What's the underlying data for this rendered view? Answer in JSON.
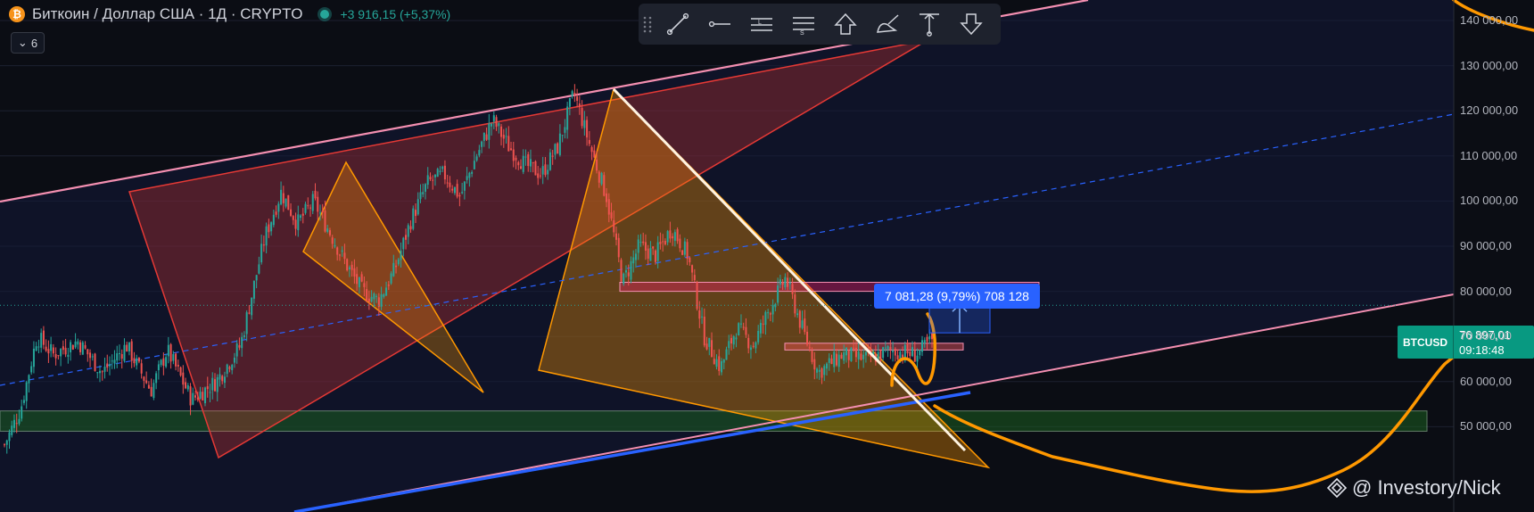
{
  "header": {
    "title": "Биткоин / Доллар США · 1Д · CRYPTO",
    "change": "+3 916,15 (+5,37%)",
    "coin_glyph": "₿"
  },
  "collapse_control": {
    "count": "6",
    "icon": "chevron-down-icon"
  },
  "toolbar": {
    "tools": [
      "trend-line-icon",
      "horizontal-ray-icon",
      "long-position-icon",
      "short-position-icon",
      "arrow-up-icon",
      "brush-icon",
      "price-range-icon",
      "arrow-down-icon"
    ]
  },
  "price_tag": {
    "symbol": "BTCUSD",
    "price": "76 897,01",
    "countdown": "09:18:48"
  },
  "measure_label": "7 081,28 (9,79%) 708 128",
  "watermark": "@ Investory/Nick",
  "colors": {
    "background": "#0b0d14",
    "up": "#26a69a",
    "down": "#ef5350",
    "channel": "#f48fb1",
    "triangle_red": "#e53935",
    "triangle_orange": "#ff9800",
    "trend_blue": "#2962ff",
    "zone_green": "#1b5e20",
    "curve_orange": "#ff9800"
  },
  "chart_data": {
    "type": "candlestick",
    "symbol": "BTCUSD",
    "timeframe": "1Д",
    "ylim": [
      45000,
      146000
    ],
    "y_axis_ticks": [
      50000,
      60000,
      70000,
      80000,
      90000,
      100000,
      110000,
      120000,
      130000,
      140000
    ],
    "y_axis_labels": [
      "50 000,00",
      "60 000,00",
      "70 000,00",
      "80 000,00",
      "90 000,00",
      "100 000,00",
      "110 000,00",
      "120 000,00",
      "130 000,00",
      "140 000,00"
    ],
    "current_price": 76897.01,
    "price_path": [
      [
        0,
        46000
      ],
      [
        0.02,
        54000
      ],
      [
        0.04,
        70000
      ],
      [
        0.06,
        66000
      ],
      [
        0.09,
        69000
      ],
      [
        0.12,
        62000
      ],
      [
        0.15,
        68000
      ],
      [
        0.18,
        58000
      ],
      [
        0.2,
        67000
      ],
      [
        0.23,
        56000
      ],
      [
        0.26,
        60000
      ],
      [
        0.29,
        68000
      ],
      [
        0.32,
        92000
      ],
      [
        0.34,
        102000
      ],
      [
        0.36,
        95000
      ],
      [
        0.38,
        100000
      ],
      [
        0.4,
        93000
      ],
      [
        0.42,
        86000
      ],
      [
        0.44,
        80000
      ],
      [
        0.46,
        78000
      ],
      [
        0.48,
        85000
      ],
      [
        0.5,
        96000
      ],
      [
        0.52,
        104000
      ],
      [
        0.54,
        106000
      ],
      [
        0.56,
        101000
      ],
      [
        0.58,
        110000
      ],
      [
        0.6,
        118000
      ],
      [
        0.62,
        112000
      ],
      [
        0.64,
        108000
      ],
      [
        0.66,
        106000
      ],
      [
        0.68,
        112000
      ],
      [
        0.7,
        124000
      ],
      [
        0.72,
        112000
      ],
      [
        0.74,
        101000
      ],
      [
        0.76,
        82000
      ],
      [
        0.78,
        90000
      ],
      [
        0.8,
        88000
      ],
      [
        0.82,
        94000
      ],
      [
        0.84,
        88000
      ],
      [
        0.86,
        70000
      ],
      [
        0.88,
        63000
      ],
      [
        0.9,
        72000
      ],
      [
        0.92,
        68000
      ],
      [
        0.94,
        76000
      ],
      [
        0.96,
        83000
      ],
      [
        0.98,
        72000
      ],
      [
        1.0,
        62000
      ],
      [
        1.03,
        66000
      ],
      [
        1.06,
        65000
      ],
      [
        1.09,
        67000
      ],
      [
        1.12,
        66000
      ],
      [
        1.14,
        69000
      ]
    ],
    "annotations": {
      "measured_move": {
        "from_price": 70800,
        "to_price": 77900,
        "label": "7 081,28 (9,79%) 708 128"
      },
      "support_zone": [
        49000,
        53500
      ],
      "resistance_zone": [
        80000,
        82000
      ],
      "mid_zone": [
        67000,
        68500
      ]
    }
  }
}
